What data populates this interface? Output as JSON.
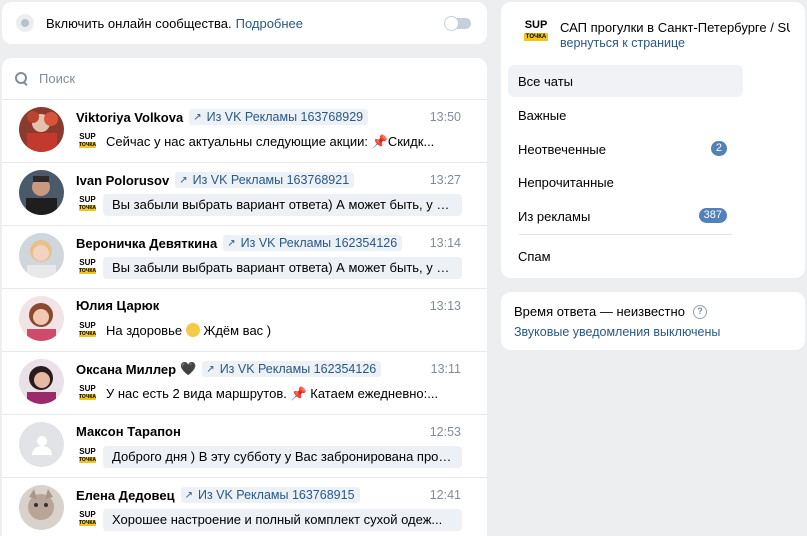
{
  "online": {
    "label": "Включить онлайн сообщества.",
    "link": "Подробнее"
  },
  "search": {
    "placeholder": "Поиск"
  },
  "chats": [
    {
      "name": "Viktoriya Volkova",
      "tag": "Из VK Рекламы 163768929",
      "time": "13:50",
      "snippet_before": "Сейчас у нас актуальны следующие акции: ",
      "snippet_icon": "pin-icon",
      "snippet_after": "Скидк...",
      "unread": false,
      "avatar": "photo-red"
    },
    {
      "name": "Ivan Polorusov",
      "tag": "Из VK Рекламы 163768921",
      "time": "13:27",
      "snippet_before": "Вы забыли выбрать вариант ответа) А может быть, у вас ест...",
      "snippet_icon": "",
      "snippet_after": "",
      "unread": true,
      "avatar": "photo-dark"
    },
    {
      "name": "Вероничка Девяткина",
      "tag": "Из VK Рекламы 162354126",
      "time": "13:14",
      "snippet_before": "Вы забыли выбрать вариант ответа) А может быть, у вас ест...",
      "snippet_icon": "",
      "snippet_after": "",
      "unread": true,
      "avatar": "photo-blonde"
    },
    {
      "name": "Юлия Царюк",
      "tag": "",
      "time": "13:13",
      "snippet_before": "На здоровье ",
      "snippet_icon": "smile-emoji-icon",
      "snippet_after": " Ждём вас )",
      "unread": false,
      "avatar": "photo-brown"
    },
    {
      "name": "Оксана Миллер",
      "name_icon": "black-heart-icon",
      "tag": "Из VK Рекламы 162354126",
      "time": "13:11",
      "snippet_before": "У нас есть 2 вида маршрутов. ",
      "snippet_icon": "pin-icon",
      "snippet_after": " Катаем ежедневно:...",
      "unread": false,
      "avatar": "photo-darkhair"
    },
    {
      "name": "Максон Тарапон",
      "tag": "",
      "time": "12:53",
      "snippet_before": "Доброго дня ) В эту субботу у Вас забронирована прогулка ...",
      "snippet_icon": "",
      "snippet_after": "",
      "unread": true,
      "avatar": "default"
    },
    {
      "name": "Елена Дедовец",
      "tag": "Из VK Рекламы 163768915",
      "time": "12:41",
      "snippet_before": "Хорошее настроение и полный комплект сухой одеж...",
      "snippet_icon": "",
      "snippet_after": "",
      "unread": true,
      "avatar": "photo-cat"
    }
  ],
  "group": {
    "logo_text": "SUP",
    "logo_sub": "ТОЧКА",
    "title": "САП прогулки в Санкт-Петербурге / SU...",
    "back": "вернуться к странице"
  },
  "menu": [
    {
      "label": "Все чаты",
      "badge": "",
      "active": true
    },
    {
      "label": "Важные",
      "badge": ""
    },
    {
      "label": "Неотвеченные",
      "badge": "2"
    },
    {
      "label": "Непрочитанные",
      "badge": ""
    },
    {
      "label": "Из рекламы",
      "badge": "387"
    },
    {
      "label": "Спам",
      "badge": ""
    }
  ],
  "response": {
    "label": "Время ответа — неизвестно",
    "help": "?",
    "sound_link": "Звуковые уведомления выключены"
  },
  "colors": {
    "link": "#2a5885",
    "badge": "#5181b8",
    "background": "#edeef0"
  }
}
